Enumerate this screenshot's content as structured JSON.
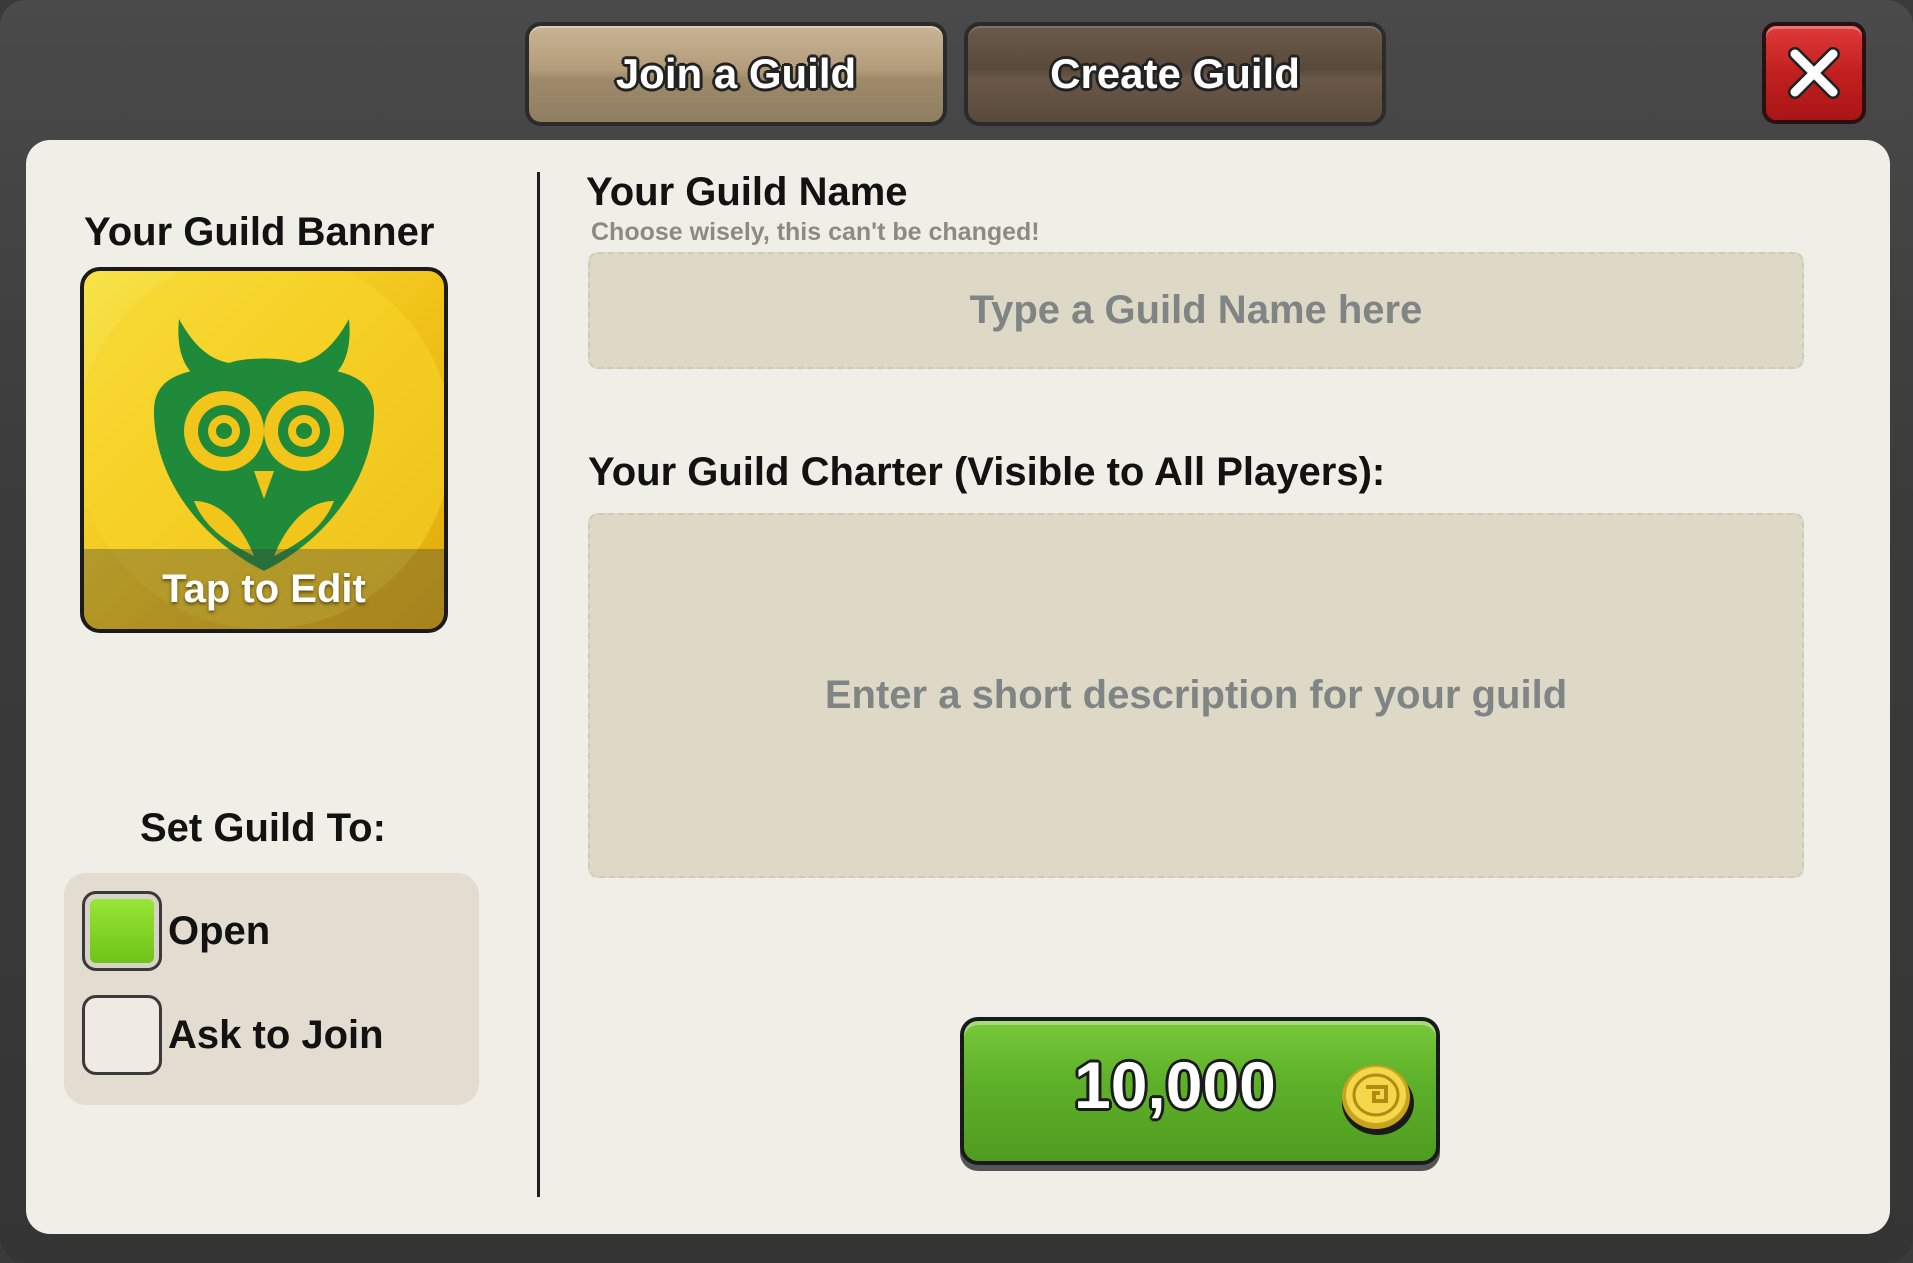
{
  "tabs": {
    "join": "Join a Guild",
    "create": "Create Guild"
  },
  "close": {
    "icon": "close-icon"
  },
  "banner": {
    "title": "Your Guild Banner",
    "caption": "Tap to Edit",
    "emblem_icon": "owl-emblem-icon",
    "colors": {
      "background": "#f2c51a",
      "emblem": "#1e8a3a"
    }
  },
  "privacy": {
    "title": "Set Guild To:",
    "options": [
      {
        "label": "Open",
        "selected": true
      },
      {
        "label": "Ask to Join",
        "selected": false
      }
    ]
  },
  "guild_name": {
    "title": "Your Guild Name",
    "subtitle": "Choose wisely, this can't be changed!",
    "placeholder": "Type a Guild Name here",
    "value": ""
  },
  "charter": {
    "title": "Your Guild Charter (Visible to All Players):",
    "placeholder": "Enter a short description for your guild",
    "value": ""
  },
  "purchase": {
    "price": "10,000",
    "currency_icon": "coin-icon",
    "color": "#5fb22a"
  }
}
